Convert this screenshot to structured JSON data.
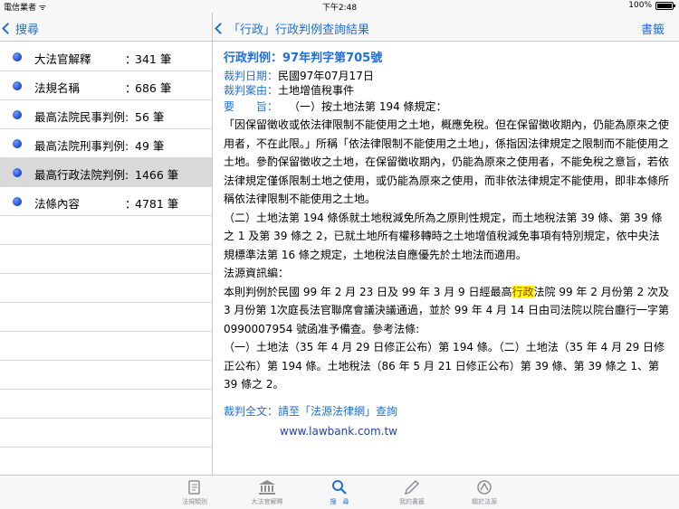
{
  "status_bar": {
    "carrier": "電信業者 ᯤ",
    "time": "下午2:48",
    "battery": "100%"
  },
  "left_nav": {
    "back_label": "搜尋"
  },
  "right_nav": {
    "back_label": "「行政」行政判例查詢結果",
    "action_label": "書籤"
  },
  "sidebar": {
    "items": [
      {
        "label": "大法官解釋",
        "colon": "：",
        "count": "341 筆"
      },
      {
        "label": "法規名稱",
        "colon": "：",
        "count": "686 筆"
      },
      {
        "label": "最高法院民事判例:",
        "colon": "",
        "count": "56 筆"
      },
      {
        "label": "最高法院刑事判例:",
        "colon": "",
        "count": "49 筆"
      },
      {
        "label": "最高行政法院判例:",
        "colon": "",
        "count": "1466 筆"
      },
      {
        "label": "法條內容",
        "colon": "：",
        "count": "4781 筆"
      }
    ]
  },
  "document": {
    "title": "行政判例：97年判字第705號",
    "date_label": "裁判日期：",
    "date_value": "民國97年07月17日",
    "case_label": "裁判案由：",
    "case_value": "土地增值稅事件",
    "gist_label": "要　　旨：",
    "gist_first": "（一）按土地法第 194 條規定：",
    "gist_body": "「因保留徵收或依法律限制不能使用之土地，概應免稅。但在保留徵收期內，仍能為原來之使用者，不在此限。」所稱「依法律限制不能使用之土地」，係指因法律規定之限制而不能使用之土地。參酌保留徵收之土地，在保留徵收期內，仍能為原來之使用者，不能免稅之意旨，若依法律規定僅係限制土地之使用，或仍能為原來之使用，而非依法律規定不能使用，即非本條所稱依法律限制不能使用之土地。",
    "gist_two": "（二）土地法第 194 條係就土地稅減免所為之原則性規定，而土地稅法第 39 條、第 39 條之 1 及第 39 條之 2，已就土地所有權移轉時之土地增值稅減免事項有特別規定，依中央法規標準法第 16 條之規定，土地稅法自應優先於土地法而適用。",
    "source_head": "法源資訊編：",
    "source_pre": "本則判例於民國 99 年 2 月 23 日及 99 年 3 月 9 日經最高",
    "source_highlight": "行政",
    "source_post": "法院 99 年 2 月份第 2 次及 3 月份第 1次庭長法官聯席會議決議通過，並於 99 年 4 月 14 日由司法院以院台廳行一字第 0990007954 號函准予備查。參考法條:",
    "source_refs": "（一）土地法（35 年 4 月 29 日修正公布）第 194 條。（二）土地法（35 年 4 月 29 日修正公布）第 194 條。土地稅法（86 年 5 月 21 日修正公布）第 39 條、第 39 條之 1、第 39 條之 2。",
    "fulltext_label": "裁判全文：請至「法源法律網」查詢",
    "url": "www.lawbank.com.tw"
  },
  "tabs": [
    {
      "label": "法規類別",
      "icon": "book-icon"
    },
    {
      "label": "大法官解釋",
      "icon": "courthouse-icon"
    },
    {
      "label": "搜　尋",
      "icon": "search-icon"
    },
    {
      "label": "我的書籤",
      "icon": "pencil-icon"
    },
    {
      "label": "關於法源",
      "icon": "lawbank-logo-icon"
    }
  ],
  "colors": {
    "accent": "#1f6fd6",
    "selected_row": "#d9d9d9",
    "highlight": "#ffff00"
  }
}
